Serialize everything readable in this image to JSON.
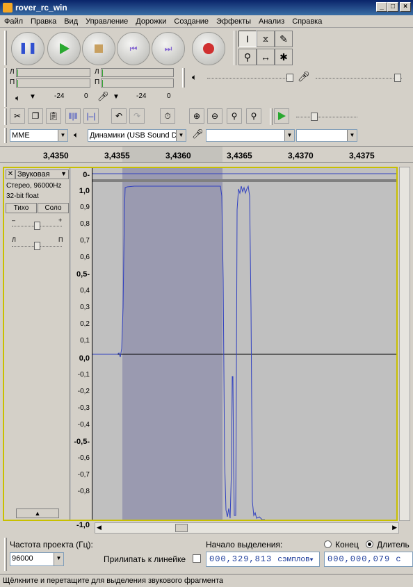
{
  "window": {
    "title": "rover_rc_win",
    "min_glyph": "_",
    "max_glyph": "□",
    "close_glyph": "×"
  },
  "menu": [
    "Файл",
    "Правка",
    "Вид",
    "Управление",
    "Дорожки",
    "Создание",
    "Эффекты",
    "Анализ",
    "Справка"
  ],
  "meters": {
    "left_short": "Л",
    "right_short": "П",
    "play_scale": [
      "-24",
      "0"
    ],
    "rec_scale": [
      "-24",
      "0"
    ]
  },
  "devices": {
    "host": "MME",
    "output": "Динамики (USB Sound De",
    "input": "",
    "channels": ""
  },
  "ruler": {
    "ticks": [
      "3,4350",
      "3,4355",
      "3,4360",
      "3,4365",
      "3,4370",
      "3,4375"
    ]
  },
  "track": {
    "name": "Звуковая",
    "info_line1": "Стерео, 96000Hz",
    "info_line2": "32-bit float",
    "mute": "Тихо",
    "solo": "Соло",
    "gain_minus": "–",
    "gain_plus": "+",
    "pan_left": "Л",
    "pan_right": "П",
    "collapse_glyph": "▲",
    "close_glyph": "✕",
    "menu_glyph": "▼"
  },
  "vscale": {
    "top_label": "0-",
    "labels": [
      "1,0",
      "0,9",
      "0,8",
      "0,7",
      "0,6",
      "0,5-",
      "0,4",
      "0,3",
      "0,2",
      "0,1",
      "0,0",
      "-0,1",
      "-0,2",
      "-0,3",
      "-0,4",
      "-0,5-",
      "-0,6",
      "-0,7",
      "-0,8",
      "",
      "-1,0"
    ]
  },
  "selection_bar": {
    "rate_label": "Частота проекта (Гц):",
    "rate_value": "96000",
    "snap_label": "Прилипать к линейке",
    "start_label": "Начало выделения:",
    "end_label": "Конец",
    "length_label": "Длитель",
    "start_value": "000,329,813",
    "start_unit": "сэмплов",
    "length_value": "000,000,079 с"
  },
  "status": "Щёлкните и перетащите для выделения звукового фрагмента",
  "colors": {
    "wave": "#3040c0",
    "selection": "#9a9ab0",
    "titlebar": "#0a246a"
  }
}
